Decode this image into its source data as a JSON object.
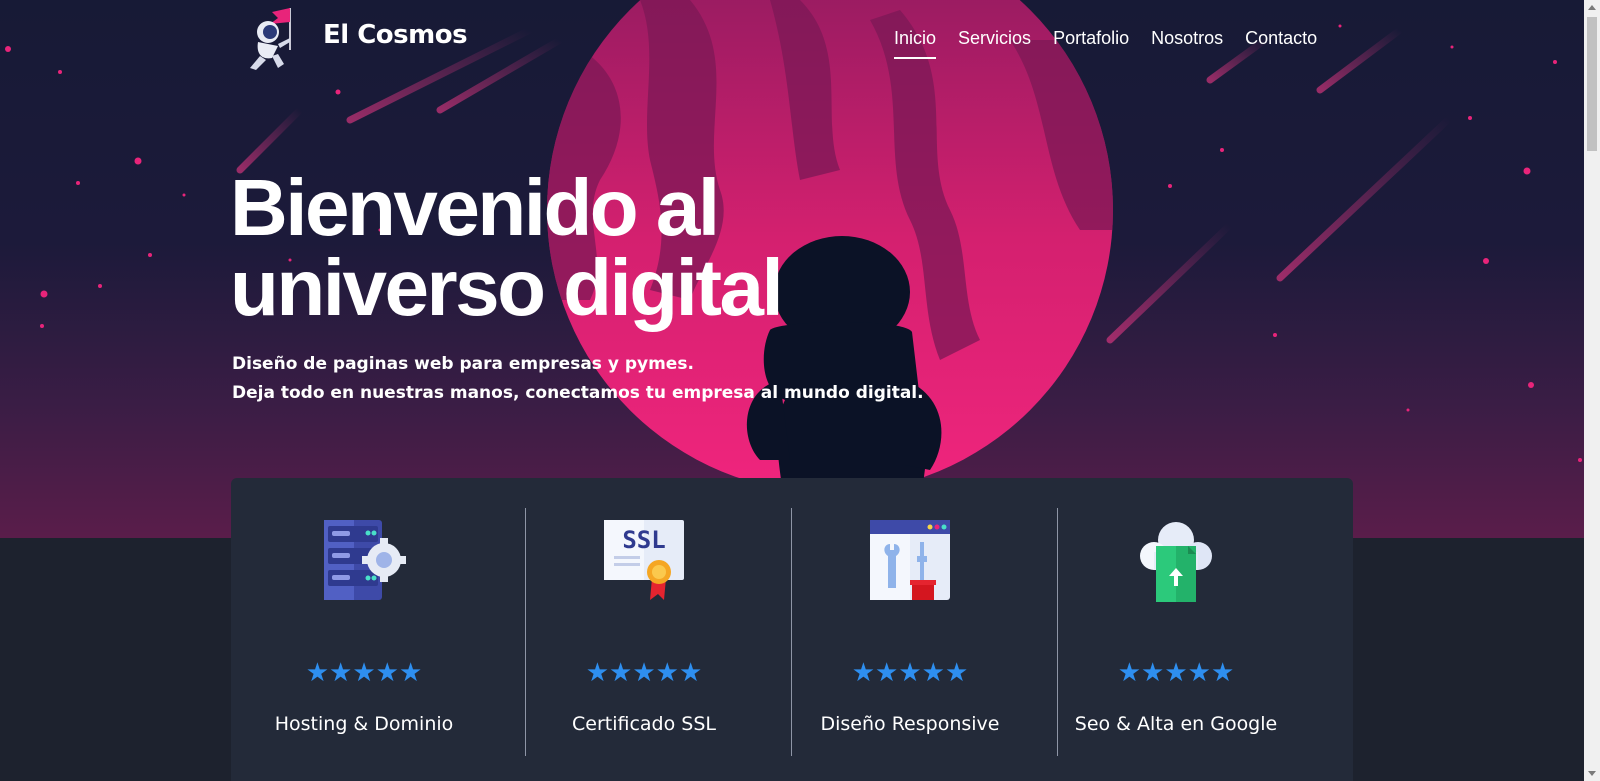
{
  "brand": {
    "name": "El Cosmos"
  },
  "nav": {
    "items": [
      {
        "label": "Inicio",
        "active": true
      },
      {
        "label": "Servicios",
        "active": false
      },
      {
        "label": "Portafolio",
        "active": false
      },
      {
        "label": "Nosotros",
        "active": false
      },
      {
        "label": "Contacto",
        "active": false
      }
    ]
  },
  "hero": {
    "title_line1": "Bienvenido al",
    "title_line2": "universo digital",
    "subtitle_line1": "Diseño de paginas web para empresas y pymes.",
    "subtitle_line2": "Deja todo en nuestras manos, conectamos tu empresa al mundo digital."
  },
  "features": [
    {
      "label": "Hosting & Dominio",
      "icon": "server-gear-icon",
      "rating": 5
    },
    {
      "label": "Certificado SSL",
      "icon": "ssl-certificate-icon",
      "rating": 5
    },
    {
      "label": "Diseño Responsive",
      "icon": "browser-tools-icon",
      "rating": 5
    },
    {
      "label": "Seo & Alta en Google",
      "icon": "cloud-upload-icon",
      "rating": 5
    }
  ],
  "colors": {
    "planet": "#e8247a",
    "star_rating": "#2e8ff0",
    "card_bg": "#232a39",
    "page_bg": "#1d222e"
  }
}
